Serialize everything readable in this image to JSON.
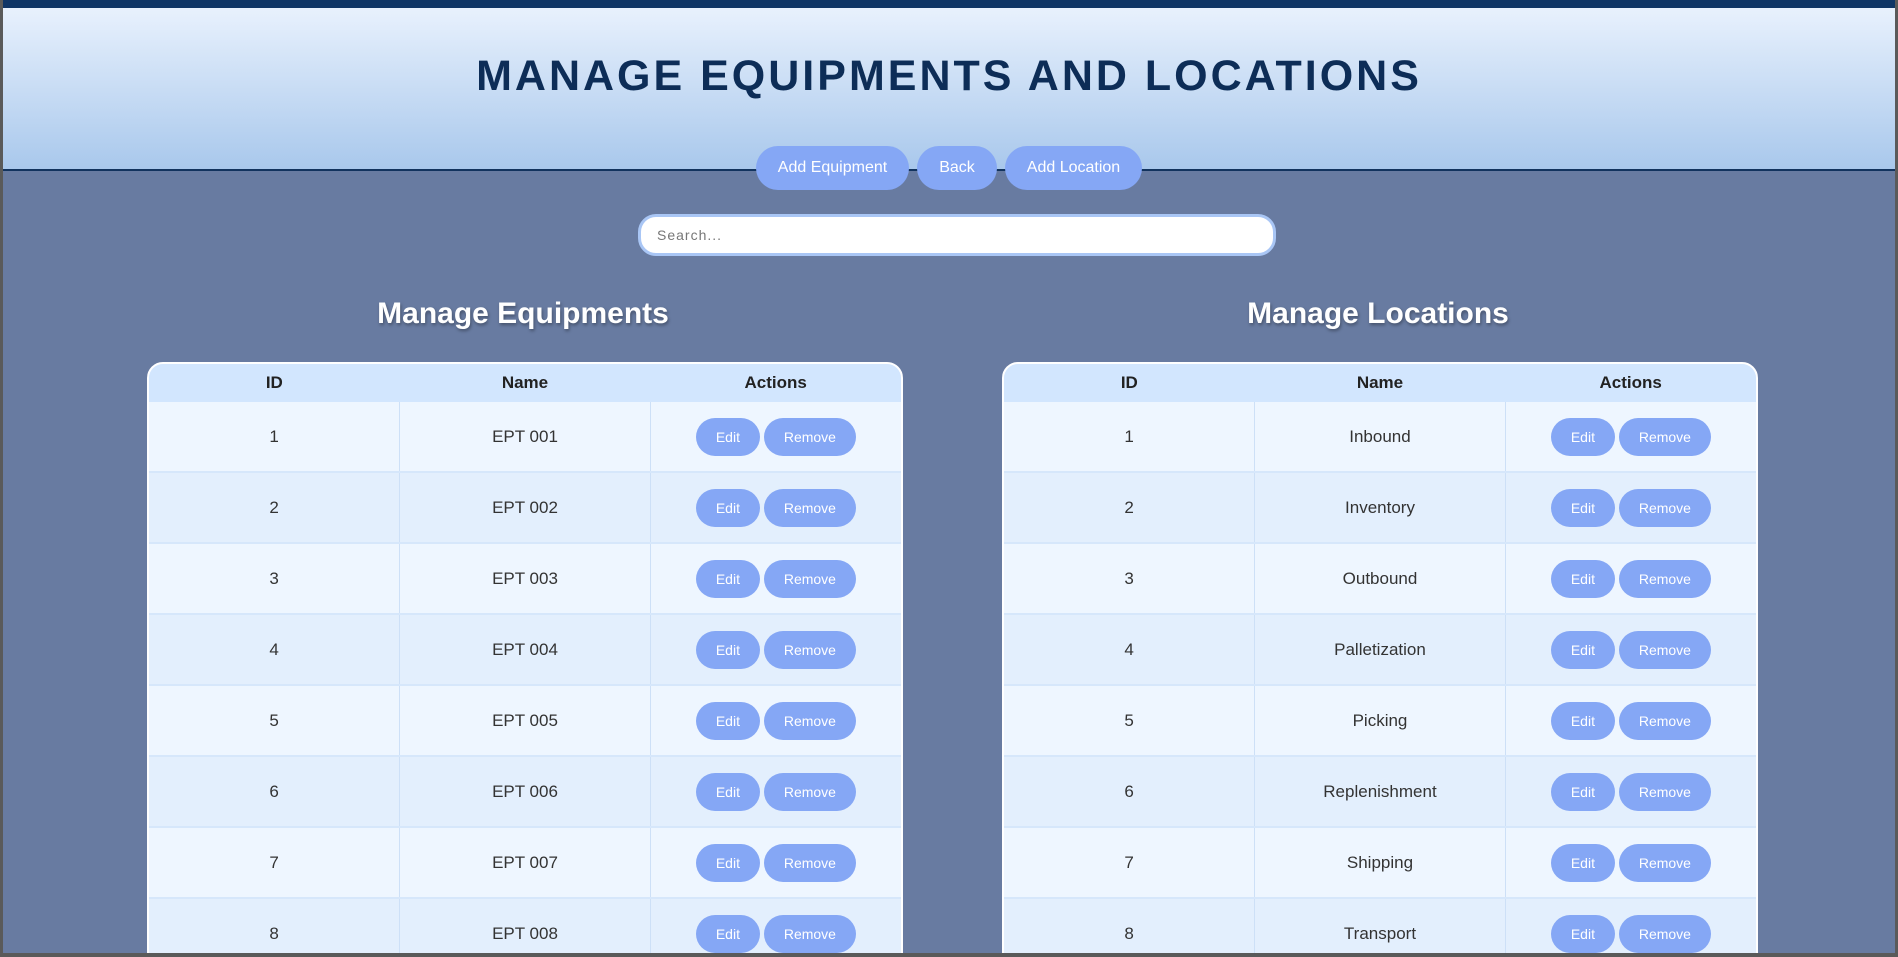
{
  "header": {
    "title": "MANAGE EQUIPMENTS AND LOCATIONS",
    "buttons": {
      "add_equipment": "Add Equipment",
      "back": "Back",
      "add_location": "Add Location"
    }
  },
  "search": {
    "placeholder": "Search..."
  },
  "equipments": {
    "title": "Manage Equipments",
    "columns": [
      "ID",
      "Name",
      "Actions"
    ],
    "rows": [
      {
        "id": "1",
        "name": "EPT 001"
      },
      {
        "id": "2",
        "name": "EPT 002"
      },
      {
        "id": "3",
        "name": "EPT 003"
      },
      {
        "id": "4",
        "name": "EPT 004"
      },
      {
        "id": "5",
        "name": "EPT 005"
      },
      {
        "id": "6",
        "name": "EPT 006"
      },
      {
        "id": "7",
        "name": "EPT 007"
      },
      {
        "id": "8",
        "name": "EPT 008"
      }
    ]
  },
  "locations": {
    "title": "Manage Locations",
    "columns": [
      "ID",
      "Name",
      "Actions"
    ],
    "rows": [
      {
        "id": "1",
        "name": "Inbound"
      },
      {
        "id": "2",
        "name": "Inventory"
      },
      {
        "id": "3",
        "name": "Outbound"
      },
      {
        "id": "4",
        "name": "Palletization"
      },
      {
        "id": "5",
        "name": "Picking"
      },
      {
        "id": "6",
        "name": "Replenishment"
      },
      {
        "id": "7",
        "name": "Shipping"
      },
      {
        "id": "8",
        "name": "Transport"
      }
    ]
  },
  "row_actions": {
    "edit": "Edit",
    "remove": "Remove"
  },
  "colors": {
    "accent": "#85a7f5",
    "background": "#687ba1",
    "title": "#0d2d57"
  }
}
